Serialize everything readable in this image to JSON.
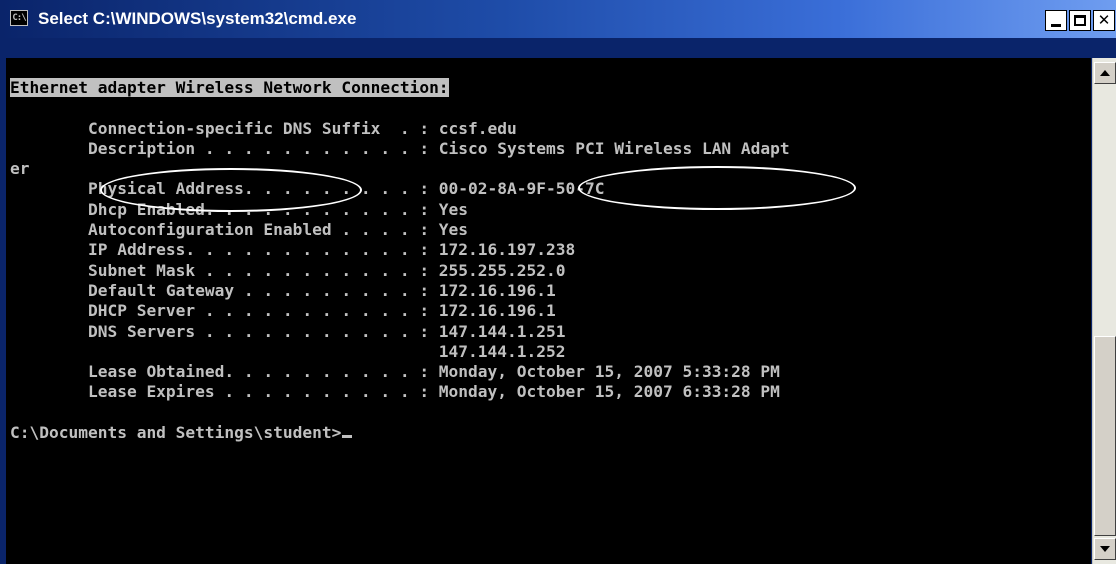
{
  "window": {
    "title": "Select C:\\WINDOWS\\system32\\cmd.exe",
    "icon": "console-icon",
    "icon_text": "C:\\"
  },
  "console": {
    "lines": [
      "Ethernet adapter Wireless Network Connection:",
      "",
      "        Connection-specific DNS Suffix  . : ccsf.edu",
      "        Description . . . . . . . . . . . : Cisco Systems PCI Wireless LAN Adapt",
      "er",
      "        Physical Address. . . . . . . . . : 00-02-8A-9F-50-7C",
      "        Dhcp Enabled. . . . . . . . . . . : Yes",
      "        Autoconfiguration Enabled . . . . : Yes",
      "        IP Address. . . . . . . . . . . . : 172.16.197.238",
      "        Subnet Mask . . . . . . . . . . . : 255.255.252.0",
      "        Default Gateway . . . . . . . . . : 172.16.196.1",
      "        DHCP Server . . . . . . . . . . . : 172.16.196.1",
      "        DNS Servers . . . . . . . . . . . : 147.144.1.251",
      "                                            147.144.1.252",
      "        Lease Obtained. . . . . . . . . . : Monday, October 15, 2007 5:33:28 PM",
      "        Lease Expires . . . . . . . . . . : Monday, October 15, 2007 6:33:28 PM",
      "",
      "C:\\Documents and Settings\\student>"
    ],
    "selected_line_index": 0
  },
  "colors": {
    "console_bg": "#000000",
    "console_fg": "#c0c0c0",
    "title_bar": "#0a246a",
    "highlight_oval": "#ffffff"
  },
  "annotations": [
    {
      "name": "physical-address-oval",
      "target": "Physical Address."
    },
    {
      "name": "mac-address-oval",
      "target": "00-02-8A-9F-50-7C"
    }
  ]
}
